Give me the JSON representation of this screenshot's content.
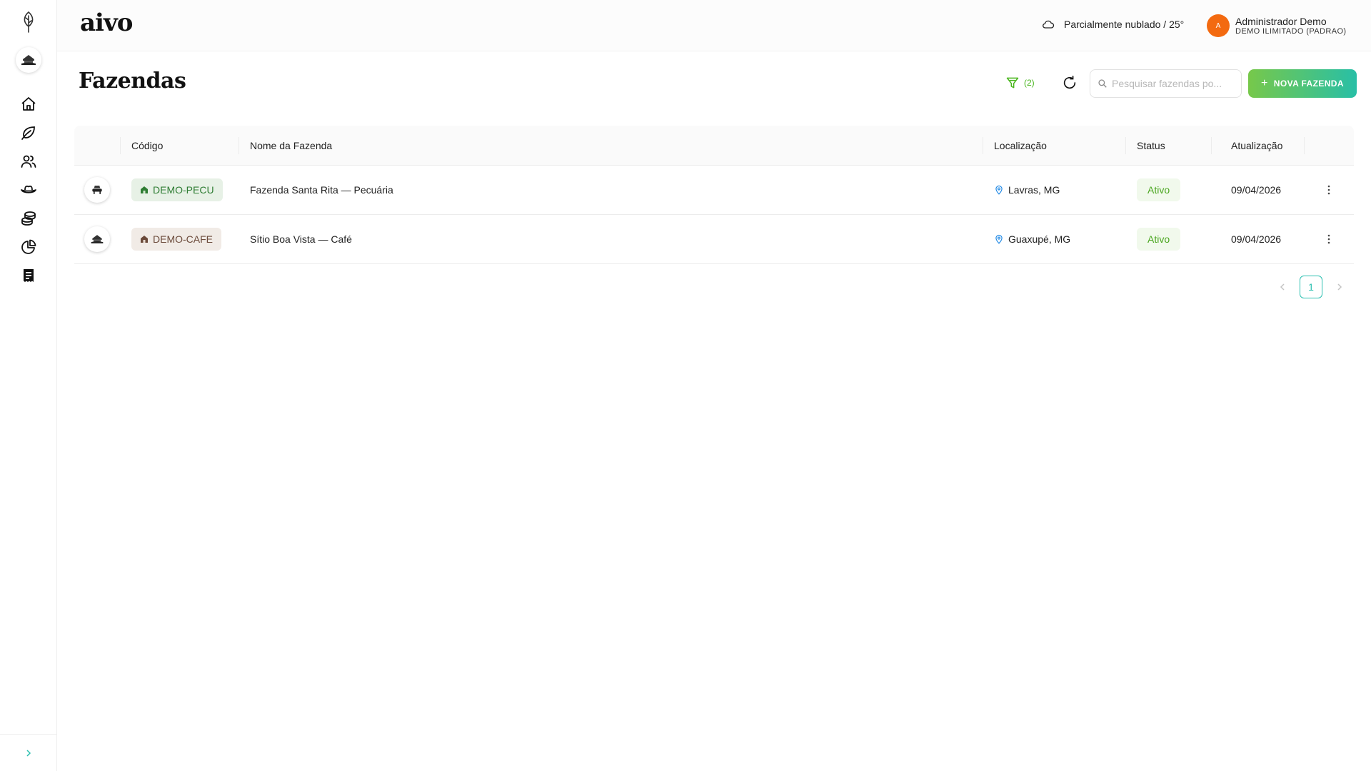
{
  "app": {
    "brand": "aivo"
  },
  "header": {
    "weather_text": "Parcialmente nublado / 25°",
    "user": {
      "initial": "A",
      "name": "Administrador Demo",
      "org": "DEMO ILIMITADO (PADRAO)"
    }
  },
  "sidebar": {
    "items": [
      {
        "icon": "home-icon"
      },
      {
        "icon": "leaf-icon"
      },
      {
        "icon": "users-icon"
      },
      {
        "icon": "cowboy-hat-icon"
      },
      {
        "icon": "coins-icon"
      },
      {
        "icon": "pie-chart-icon"
      },
      {
        "icon": "receipt-icon"
      }
    ]
  },
  "page": {
    "title": "Fazendas",
    "filter_count": "(2)",
    "search_placeholder": "Pesquisar fazendas po...",
    "new_button": "NOVA FAZENDA"
  },
  "table": {
    "headers": {
      "code": "Código",
      "name": "Nome da Fazenda",
      "location": "Localização",
      "status": "Status",
      "updated": "Atualização"
    },
    "rows": [
      {
        "code": "DEMO-PECU",
        "name": "Fazenda Santa Rita — Pecuária",
        "location": "Lavras, MG",
        "status": "Ativo",
        "updated": "09/04/2026",
        "tag_color": "#2f7d34"
      },
      {
        "code": "DEMO-CAFE",
        "name": "Sítio Boa Vista — Café",
        "location": "Guaxupé, MG",
        "status": "Ativo",
        "updated": "09/04/2026",
        "tag_color": "#6b4a3a"
      }
    ]
  },
  "pagination": {
    "current": "1"
  },
  "colors": {
    "accent_green": "#47b51b",
    "accent_teal": "#2bbfb0",
    "avatar_orange": "#f36a10"
  }
}
